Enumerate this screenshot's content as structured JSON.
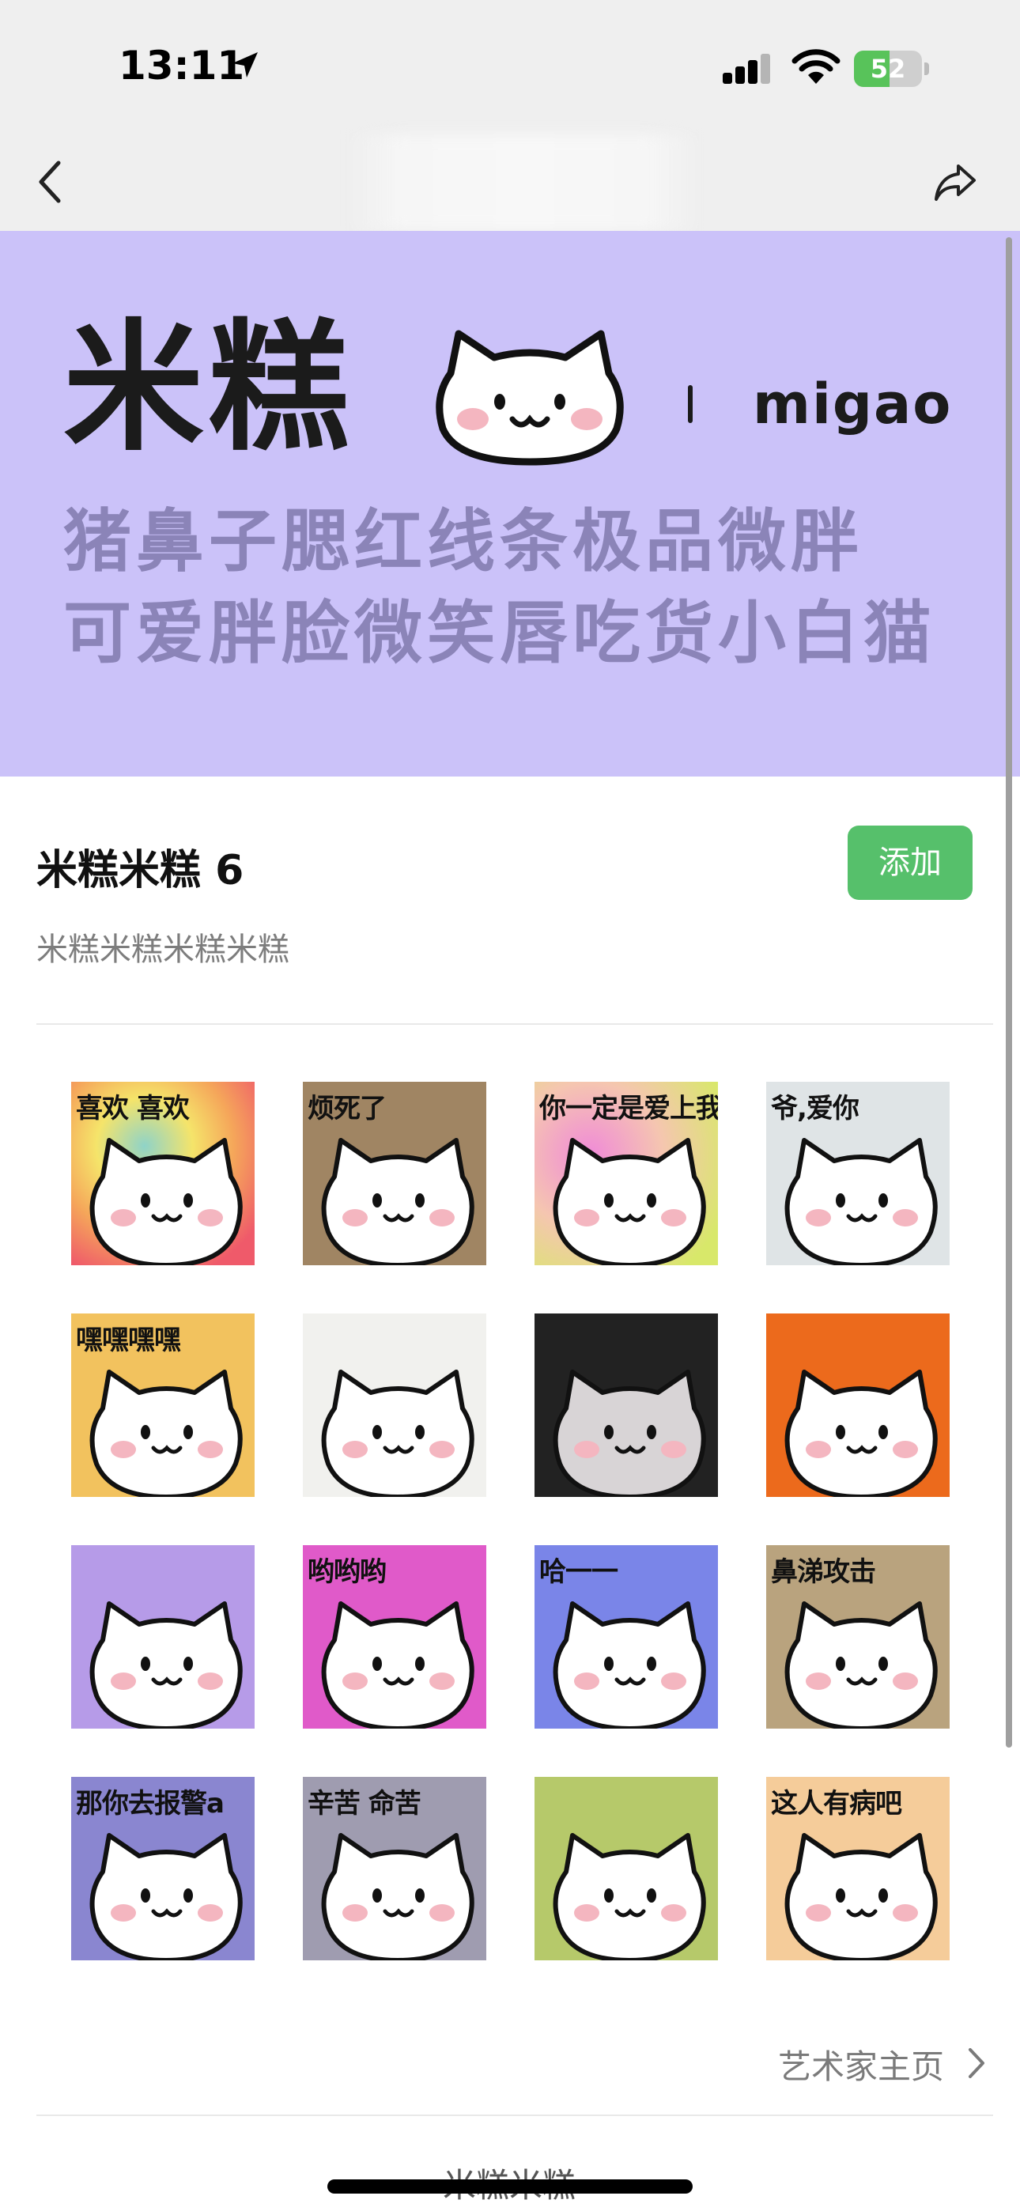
{
  "status_bar": {
    "time": "13:11",
    "battery": "52",
    "battery_level": 0.52
  },
  "nav": {
    "back_icon": "chevron-left-icon",
    "share_icon": "share-arrow-icon"
  },
  "banner": {
    "title": "米糕",
    "sub": "migao",
    "tagline_1": "猪鼻子腮红线条极品微胖",
    "tagline_2": "可爱胖脸微笑唇吃货小白猫",
    "bg_color": "#cbc2f9"
  },
  "pack": {
    "title": "米糕米糕 6",
    "description": "米糕米糕米糕米糕",
    "add_label": "添加",
    "accent_color": "#56c06b"
  },
  "stickers": [
    {
      "caption": "喜欢 喜欢",
      "bg": "rainbow"
    },
    {
      "caption": "烦死了",
      "bg": "#a08563"
    },
    {
      "caption": "你一定是爱上我了",
      "bg": "pink-yellow"
    },
    {
      "caption": "爷,爱你",
      "bg": "#dfe4e6"
    },
    {
      "caption": "嘿嘿嘿嘿",
      "bg": "#f2c25e"
    },
    {
      "caption": "",
      "bg": "#f1f1ee"
    },
    {
      "caption": "",
      "bg": "#222222"
    },
    {
      "caption": "",
      "bg": "#ec6a1c"
    },
    {
      "caption": "",
      "bg": "#b69be8"
    },
    {
      "caption": "哟哟哟",
      "bg": "#e05ac9"
    },
    {
      "caption": "哈一一",
      "bg": "#7a85e8"
    },
    {
      "caption": "鼻涕攻击",
      "bg": "#b9a37e"
    },
    {
      "caption": "那你去报警a",
      "bg": "#8a86d0"
    },
    {
      "caption": "辛苦 命苦",
      "bg": "#9f9cb0"
    },
    {
      "caption": "",
      "bg": "#b6c96a"
    },
    {
      "caption": "这人有病吧",
      "bg": "#f5cc9a"
    }
  ],
  "footer": {
    "artist_link": "艺术家主页",
    "next_pack_title": "米糕米糕"
  }
}
